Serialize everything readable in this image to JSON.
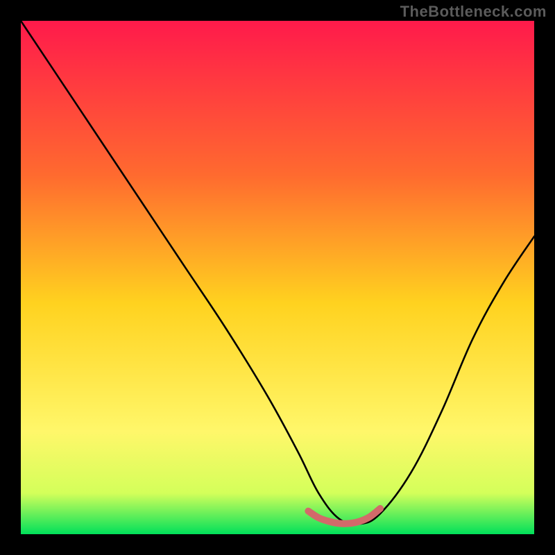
{
  "watermark": "TheBottleneck.com",
  "colors": {
    "frame": "#000000",
    "curve": "#000000",
    "highlight": "#d26a6a",
    "grad_top": "#ff1a4b",
    "grad_mid_upper": "#ff7a2d",
    "grad_mid": "#ffd21f",
    "grad_mid_lower": "#fff76a",
    "grad_near_bottom": "#d4ff5a",
    "grad_bottom": "#00e05a"
  },
  "chart_data": {
    "type": "line",
    "title": "",
    "xlabel": "",
    "ylabel": "",
    "xlim": [
      0,
      100
    ],
    "ylim": [
      0,
      100
    ],
    "series": [
      {
        "name": "curve",
        "x": [
          0,
          8,
          16,
          24,
          32,
          40,
          48,
          54,
          58,
          62,
          66,
          70,
          76,
          82,
          88,
          94,
          100
        ],
        "y": [
          100,
          88,
          76,
          64,
          52,
          40,
          27,
          16,
          8,
          3,
          2,
          4,
          12,
          24,
          38,
          49,
          58
        ]
      },
      {
        "name": "optimal-range-highlight",
        "x": [
          56,
          58,
          60,
          62,
          64,
          66,
          68,
          70
        ],
        "y": [
          4.5,
          3.2,
          2.5,
          2.1,
          2.1,
          2.5,
          3.4,
          5.0
        ]
      }
    ],
    "background": {
      "gradient_stops": [
        {
          "offset": 0.0,
          "color": "#ff1a4b"
        },
        {
          "offset": 0.3,
          "color": "#ff6a2f"
        },
        {
          "offset": 0.55,
          "color": "#ffd21f"
        },
        {
          "offset": 0.8,
          "color": "#fff76a"
        },
        {
          "offset": 0.92,
          "color": "#d4ff5a"
        },
        {
          "offset": 1.0,
          "color": "#00e05a"
        }
      ]
    }
  }
}
